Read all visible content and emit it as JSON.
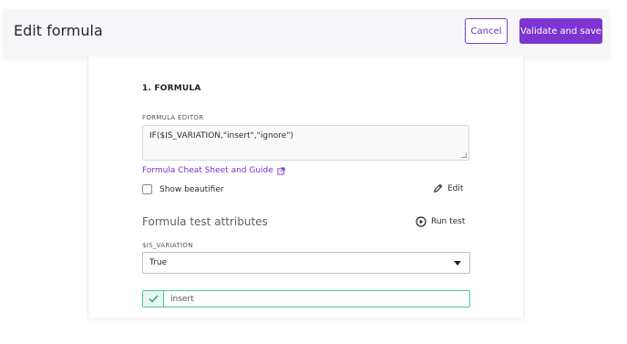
{
  "header": {
    "title": "Edit formula",
    "cancel_label": "Cancel",
    "save_label": "Validate and save"
  },
  "formula": {
    "section_title": "1. FORMULA",
    "editor_label": "FORMULA EDITOR",
    "editor_value": "IF($IS_VARIATION,\"insert\",\"ignore\")",
    "cheat_sheet_link": "Formula Cheat Sheet and Guide",
    "beautifier_label": "Show beautifier",
    "beautifier_checked": false,
    "edit_label": "Edit"
  },
  "test": {
    "title": "Formula test attributes",
    "run_label": "Run test",
    "attribute_label": "$IS_VARIATION",
    "attribute_value": "True",
    "result_value": "insert"
  },
  "icons": {
    "external_link": "external-link-icon",
    "edit": "pencil-icon",
    "run": "play-circle-icon",
    "select": "caret-down-icon",
    "result": "check-icon"
  },
  "colors": {
    "accent": "#7d34d1",
    "success": "#4fc3a7"
  }
}
